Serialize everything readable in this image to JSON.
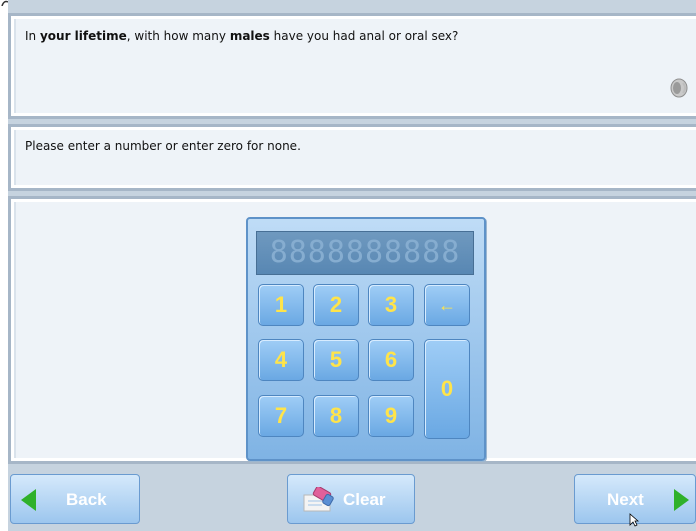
{
  "question": {
    "prefix": "In ",
    "bold1": "your lifetime",
    "middle": ", with how many ",
    "bold2": "males",
    "suffix": " have you had anal or oral sex?",
    "audio_icon": "speaker-icon"
  },
  "instruction": {
    "text": "Please enter a number or enter zero for none."
  },
  "keypad": {
    "display_placeholder": "8888888888",
    "keys": {
      "k1": "1",
      "k2": "2",
      "k3": "3",
      "backspace": "←",
      "k4": "4",
      "k5": "5",
      "k6": "6",
      "k7": "7",
      "k8": "8",
      "k9": "9",
      "k0": "0"
    }
  },
  "nav": {
    "back_label": "Back",
    "clear_label": "Clear",
    "next_label": "Next"
  },
  "colors": {
    "accent_green": "#2fb12a",
    "key_text": "#ffe44a",
    "panel_border": "#a6b6c7"
  }
}
